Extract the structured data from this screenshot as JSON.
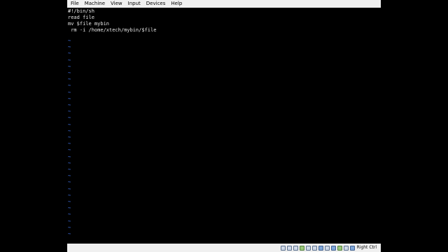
{
  "menubar": {
    "items": [
      "File",
      "Machine",
      "View",
      "Input",
      "Devices",
      "Help"
    ]
  },
  "terminal": {
    "lines": [
      "#!/bin/sh",
      "read file",
      "mv $file mybin",
      " rm -i /home/xtech/mybin/$file"
    ],
    "tilde": "~"
  },
  "statusbar": {
    "host_key": "Right Ctrl",
    "icons": [
      "hard-disk-icon",
      "optical-drive-icon",
      "audio-icon",
      "network-icon",
      "usb-icon",
      "shared-folders-icon",
      "display-icon",
      "video-capture-icon",
      "guest-additions-icon",
      "cpu-icon",
      "mouse-integration-icon",
      "keyboard-icon"
    ]
  },
  "colors": {
    "menubar_bg": "#f0f0f0",
    "screen_bg": "#000000",
    "text": "#e6e6e6",
    "tilde": "#3c6bd8"
  }
}
